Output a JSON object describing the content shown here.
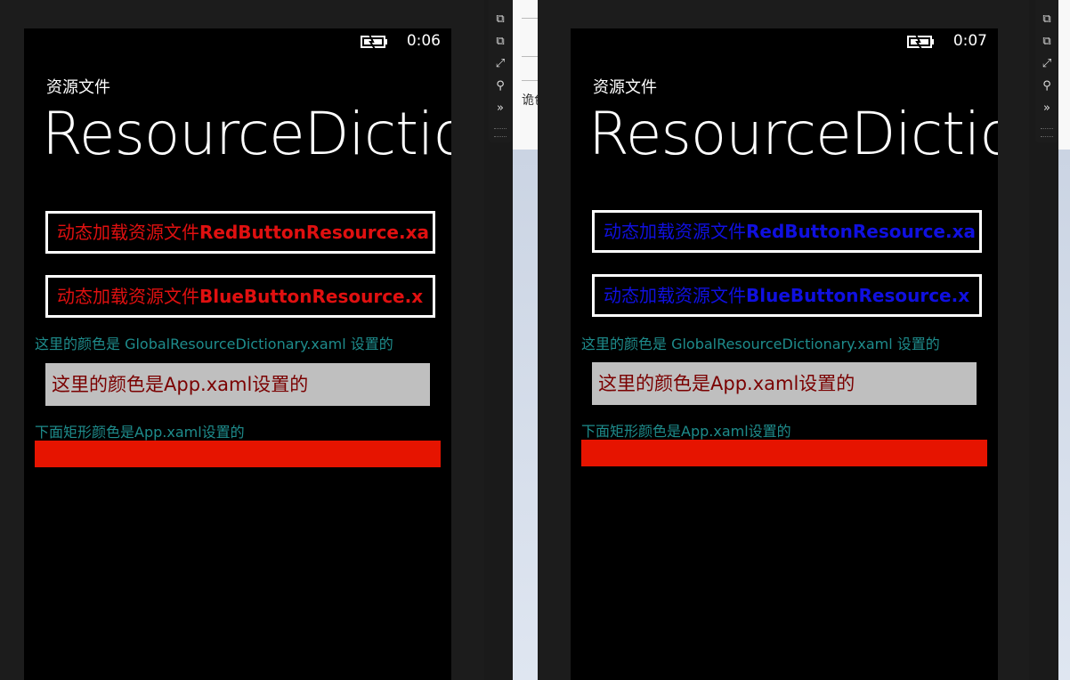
{
  "screens": [
    {
      "time": "0:06",
      "app_title": "资源文件",
      "page_title": "ResourceDictio",
      "buttons": [
        {
          "prefix": "动态加载资源文件",
          "name": "RedButtonResource.xa"
        },
        {
          "prefix": "动态加载资源文件",
          "name": "BlueButtonResource.x"
        }
      ],
      "global_text": "这里的颜色是 GlobalResourceDictionary.xaml 设置的",
      "grey_box_text": "这里的颜色是App.xaml设置的",
      "rect_label": "下面矩形颜色是App.xaml设置的",
      "button_color": "#e01010"
    },
    {
      "time": "0:07",
      "app_title": "资源文件",
      "page_title": "ResourceDictio",
      "buttons": [
        {
          "prefix": "动态加载资源文件",
          "name": "RedButtonResource.xa"
        },
        {
          "prefix": "动态加载资源文件",
          "name": "BlueButtonResource.x"
        }
      ],
      "global_text": "这里的颜色是 GlobalResourceDictionary.xaml 设置的",
      "grey_box_text": "这里的颜色是App.xaml设置的",
      "rect_label": "下面矩形颜色是App.xaml设置的",
      "button_color": "#1010e0"
    }
  ],
  "desk_partial_text": "诡色",
  "toolbar_icons": [
    "rotate-left-icon",
    "rotate-right-icon",
    "fit-screen-icon",
    "zoom-icon",
    "more-icon"
  ],
  "colors": {
    "teal_text": "#1e8c8c",
    "grey_box": "#bfbfbf",
    "grey_box_text": "#7a0000",
    "red_rect": "#e61400"
  }
}
